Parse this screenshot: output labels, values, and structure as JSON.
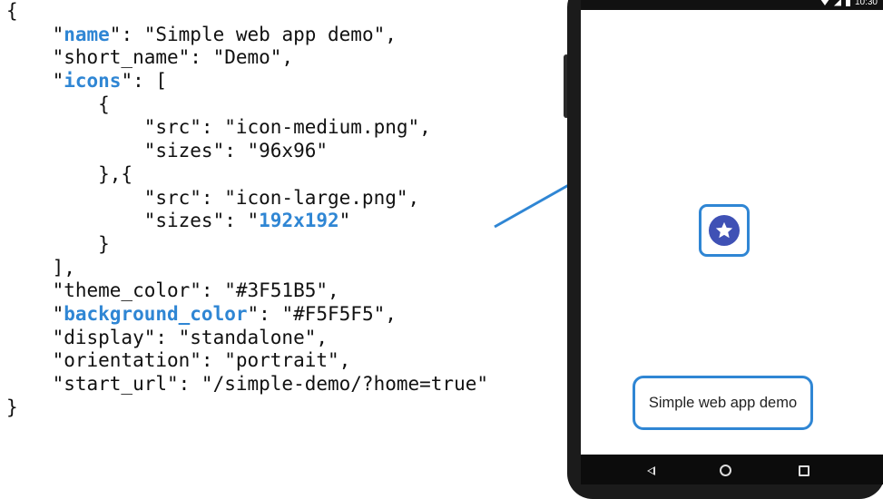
{
  "manifest_lines": [
    [
      {
        "t": "{"
      }
    ],
    [
      {
        "t": "    \""
      },
      {
        "t": "name",
        "hl": true
      },
      {
        "t": "\": \"Simple web app demo\","
      }
    ],
    [
      {
        "t": "    \"short_name\": \"Demo\","
      }
    ],
    [
      {
        "t": "    \""
      },
      {
        "t": "icons",
        "hl": true
      },
      {
        "t": "\": ["
      }
    ],
    [
      {
        "t": "        {"
      }
    ],
    [
      {
        "t": "            \"src\": \"icon-medium.png\","
      }
    ],
    [
      {
        "t": "            \"sizes\": \"96x96\""
      }
    ],
    [
      {
        "t": "        },{"
      }
    ],
    [
      {
        "t": "            \"src\": \"icon-large.png\","
      }
    ],
    [
      {
        "t": "            \"sizes\": \""
      },
      {
        "t": "192x192",
        "hl": true
      },
      {
        "t": "\""
      }
    ],
    [
      {
        "t": "        }"
      }
    ],
    [
      {
        "t": "    ],"
      }
    ],
    [
      {
        "t": "    \"theme_color\": \"#3F51B5\","
      }
    ],
    [
      {
        "t": "    \""
      },
      {
        "t": "background_color",
        "hl": true
      },
      {
        "t": "\": \"#F5F5F5\","
      }
    ],
    [
      {
        "t": "    \"display\": \"standalone\","
      }
    ],
    [
      {
        "t": "    \"orientation\": \"portrait\","
      }
    ],
    [
      {
        "t": "    \"start_url\": \"/simple-demo/?home=true\""
      }
    ],
    [
      {
        "t": "}"
      }
    ]
  ],
  "phone": {
    "splash_label": "Simple web app demo",
    "status_time": "10:30",
    "icon": "star-icon",
    "nav_icons": [
      "back-icon",
      "home-icon",
      "recent-apps-icon"
    ]
  },
  "colors": {
    "highlight": "#2f86d4",
    "theme_color": "#3F51B5",
    "arrow": "#2f86d4"
  }
}
